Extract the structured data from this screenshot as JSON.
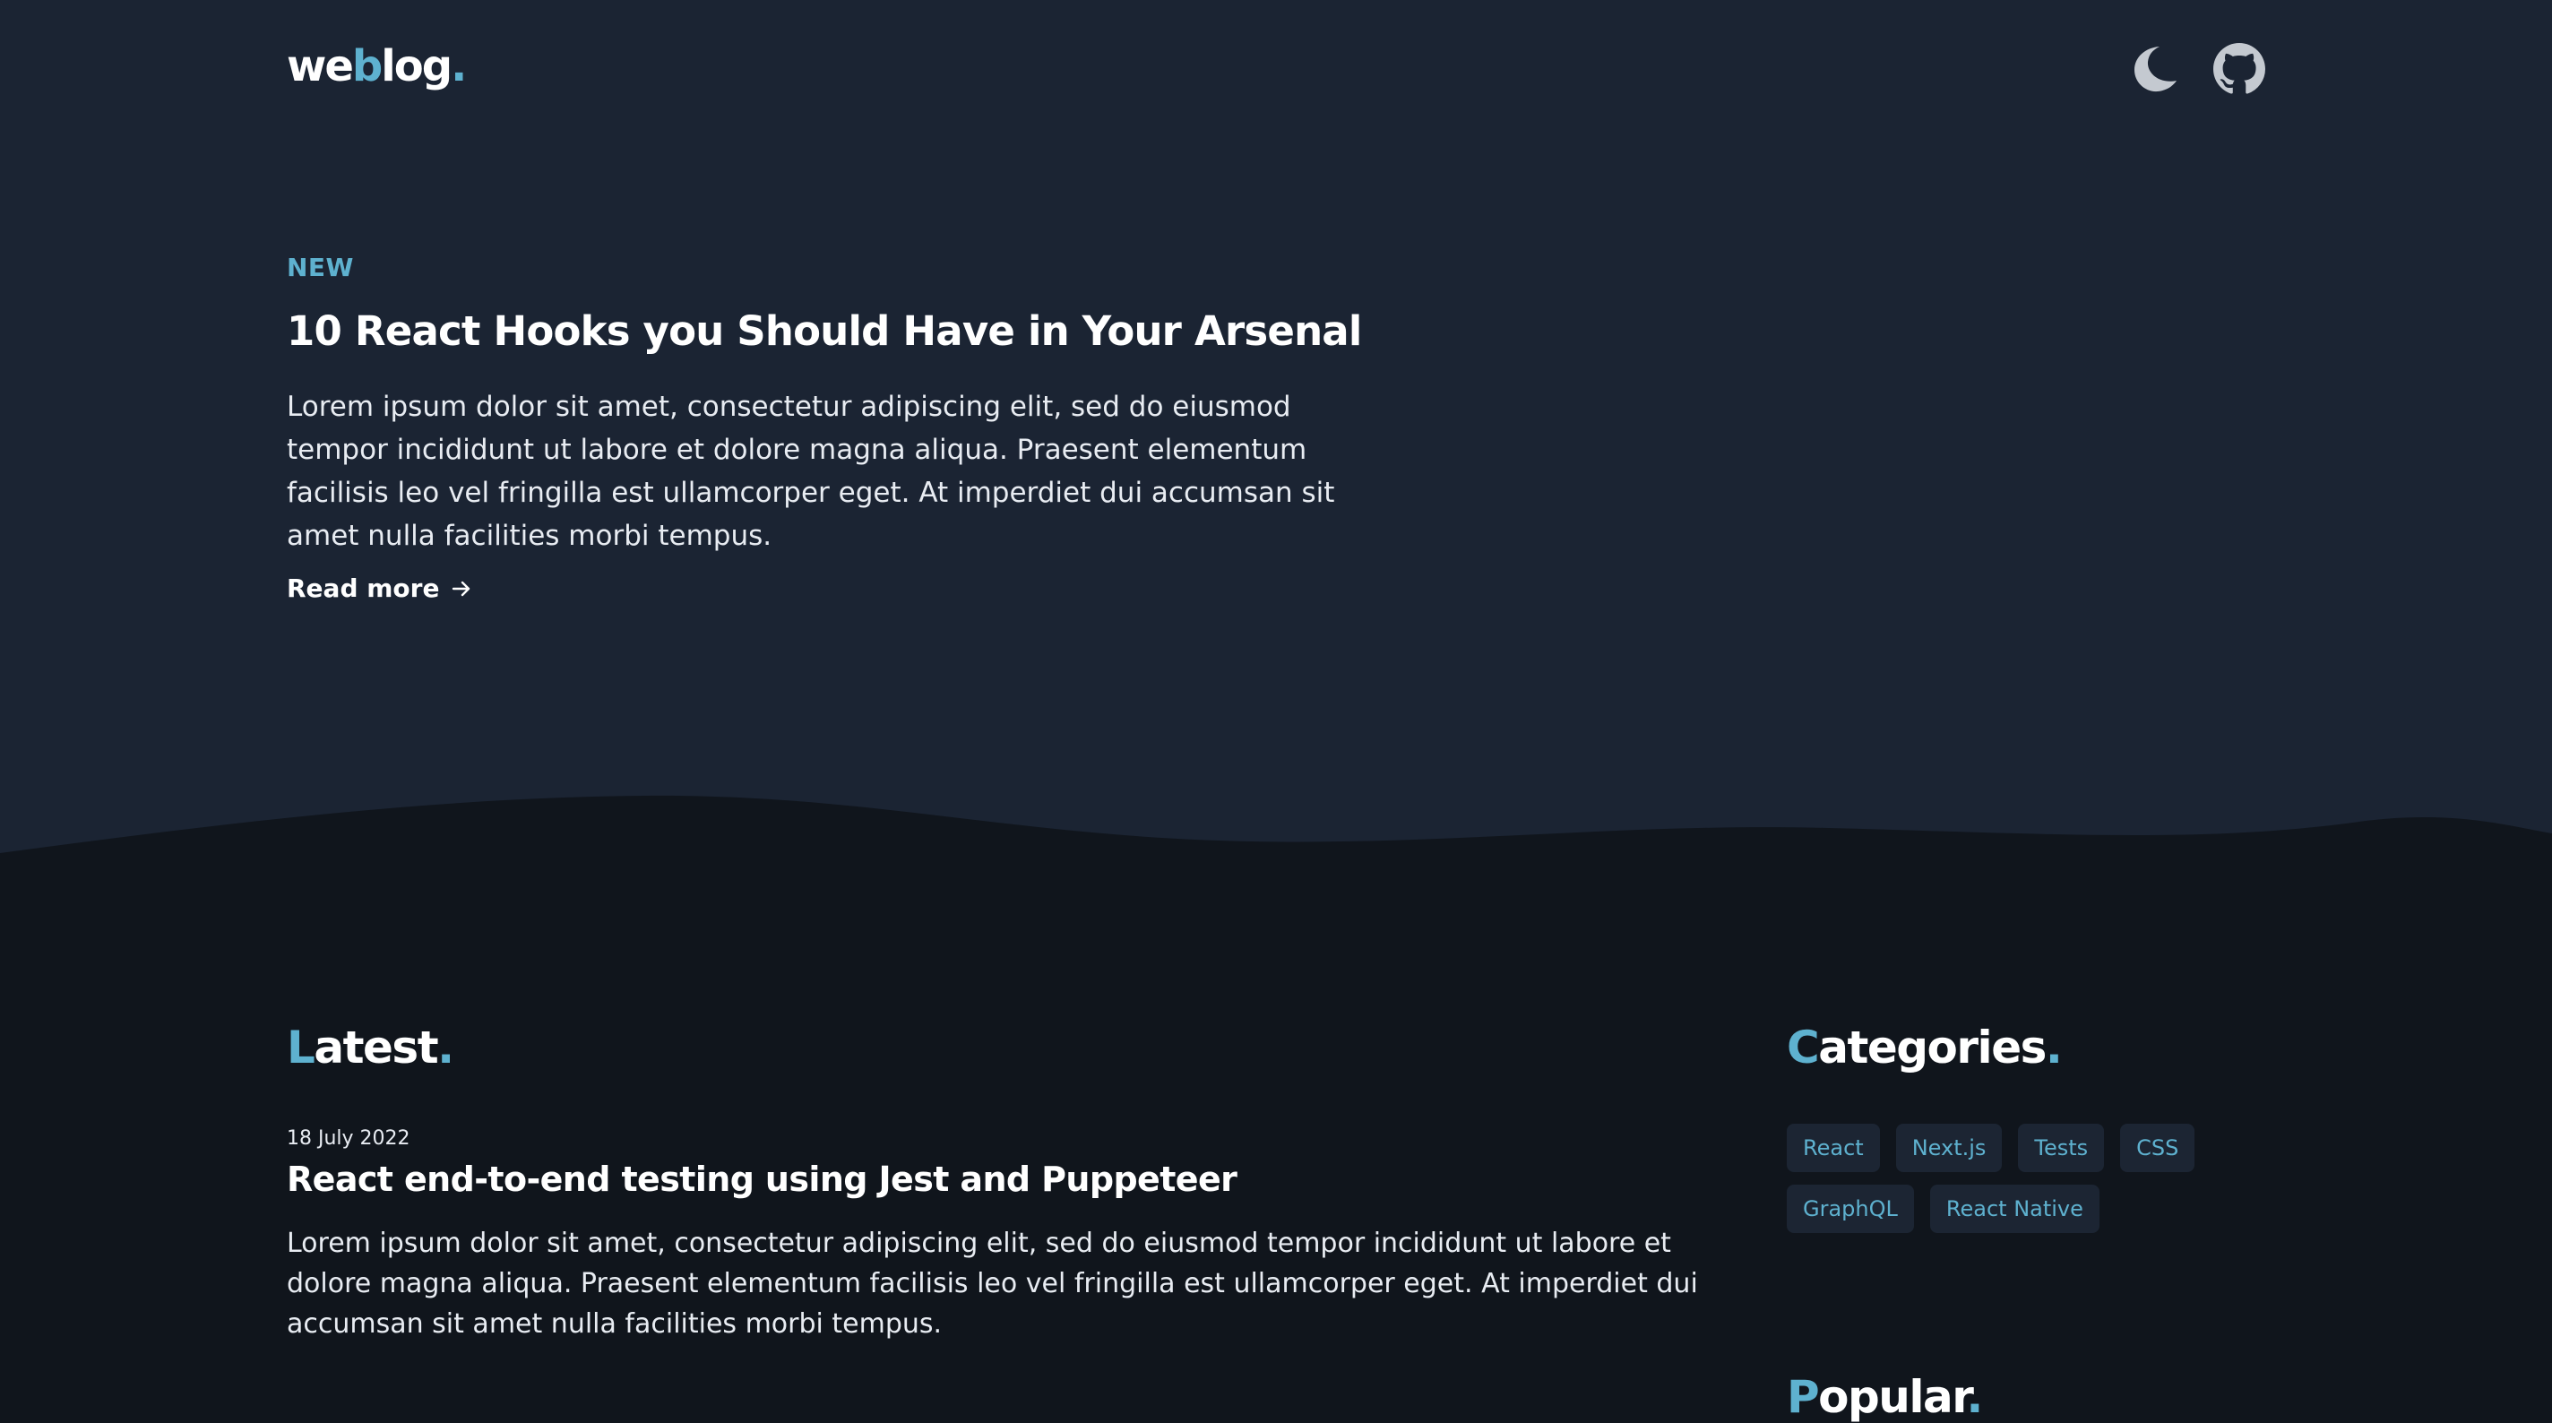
{
  "header": {
    "logo": {
      "part1": "we",
      "part2": "b",
      "part3": "log",
      "dot": "."
    },
    "theme_toggle_icon": "moon-icon",
    "github_icon": "github-icon"
  },
  "featured": {
    "badge": "NEW",
    "title": "10 React Hooks you Should Have in Your Arsenal",
    "excerpt": "Lorem ipsum dolor sit amet, consectetur adipiscing elit, sed do eiusmod tempor incididunt ut labore et dolore magna aliqua. Praesent elementum facilisis leo vel fringilla est ullamcorper eget. At imperdiet dui accumsan sit amet nulla facilities morbi tempus.",
    "read_more": "Read more",
    "read_more_icon": "arrow-right-icon"
  },
  "latest": {
    "heading_first": "L",
    "heading_rest": "atest",
    "heading_dot": ".",
    "posts": [
      {
        "date": "18 July 2022",
        "title": "React end-to-end testing using Jest and Puppeteer",
        "excerpt": "Lorem ipsum dolor sit amet, consectetur adipiscing elit, sed do eiusmod tempor incididunt ut labore et dolore magna aliqua. Praesent elementum facilisis leo vel fringilla est ullamcorper eget. At imperdiet dui accumsan sit amet nulla facilities morbi tempus."
      }
    ]
  },
  "categories": {
    "heading_first": "C",
    "heading_rest": "ategories",
    "heading_dot": ".",
    "tags": [
      "React",
      "Next.js",
      "Tests",
      "CSS",
      "GraphQL",
      "React Native"
    ]
  },
  "popular": {
    "heading_first": "P",
    "heading_rest": "opular",
    "heading_dot": "."
  },
  "colors": {
    "accent": "#5eb1cf",
    "hero_bg": "#1b2433",
    "page_bg": "#10151c",
    "tag_bg": "#1c2533"
  }
}
